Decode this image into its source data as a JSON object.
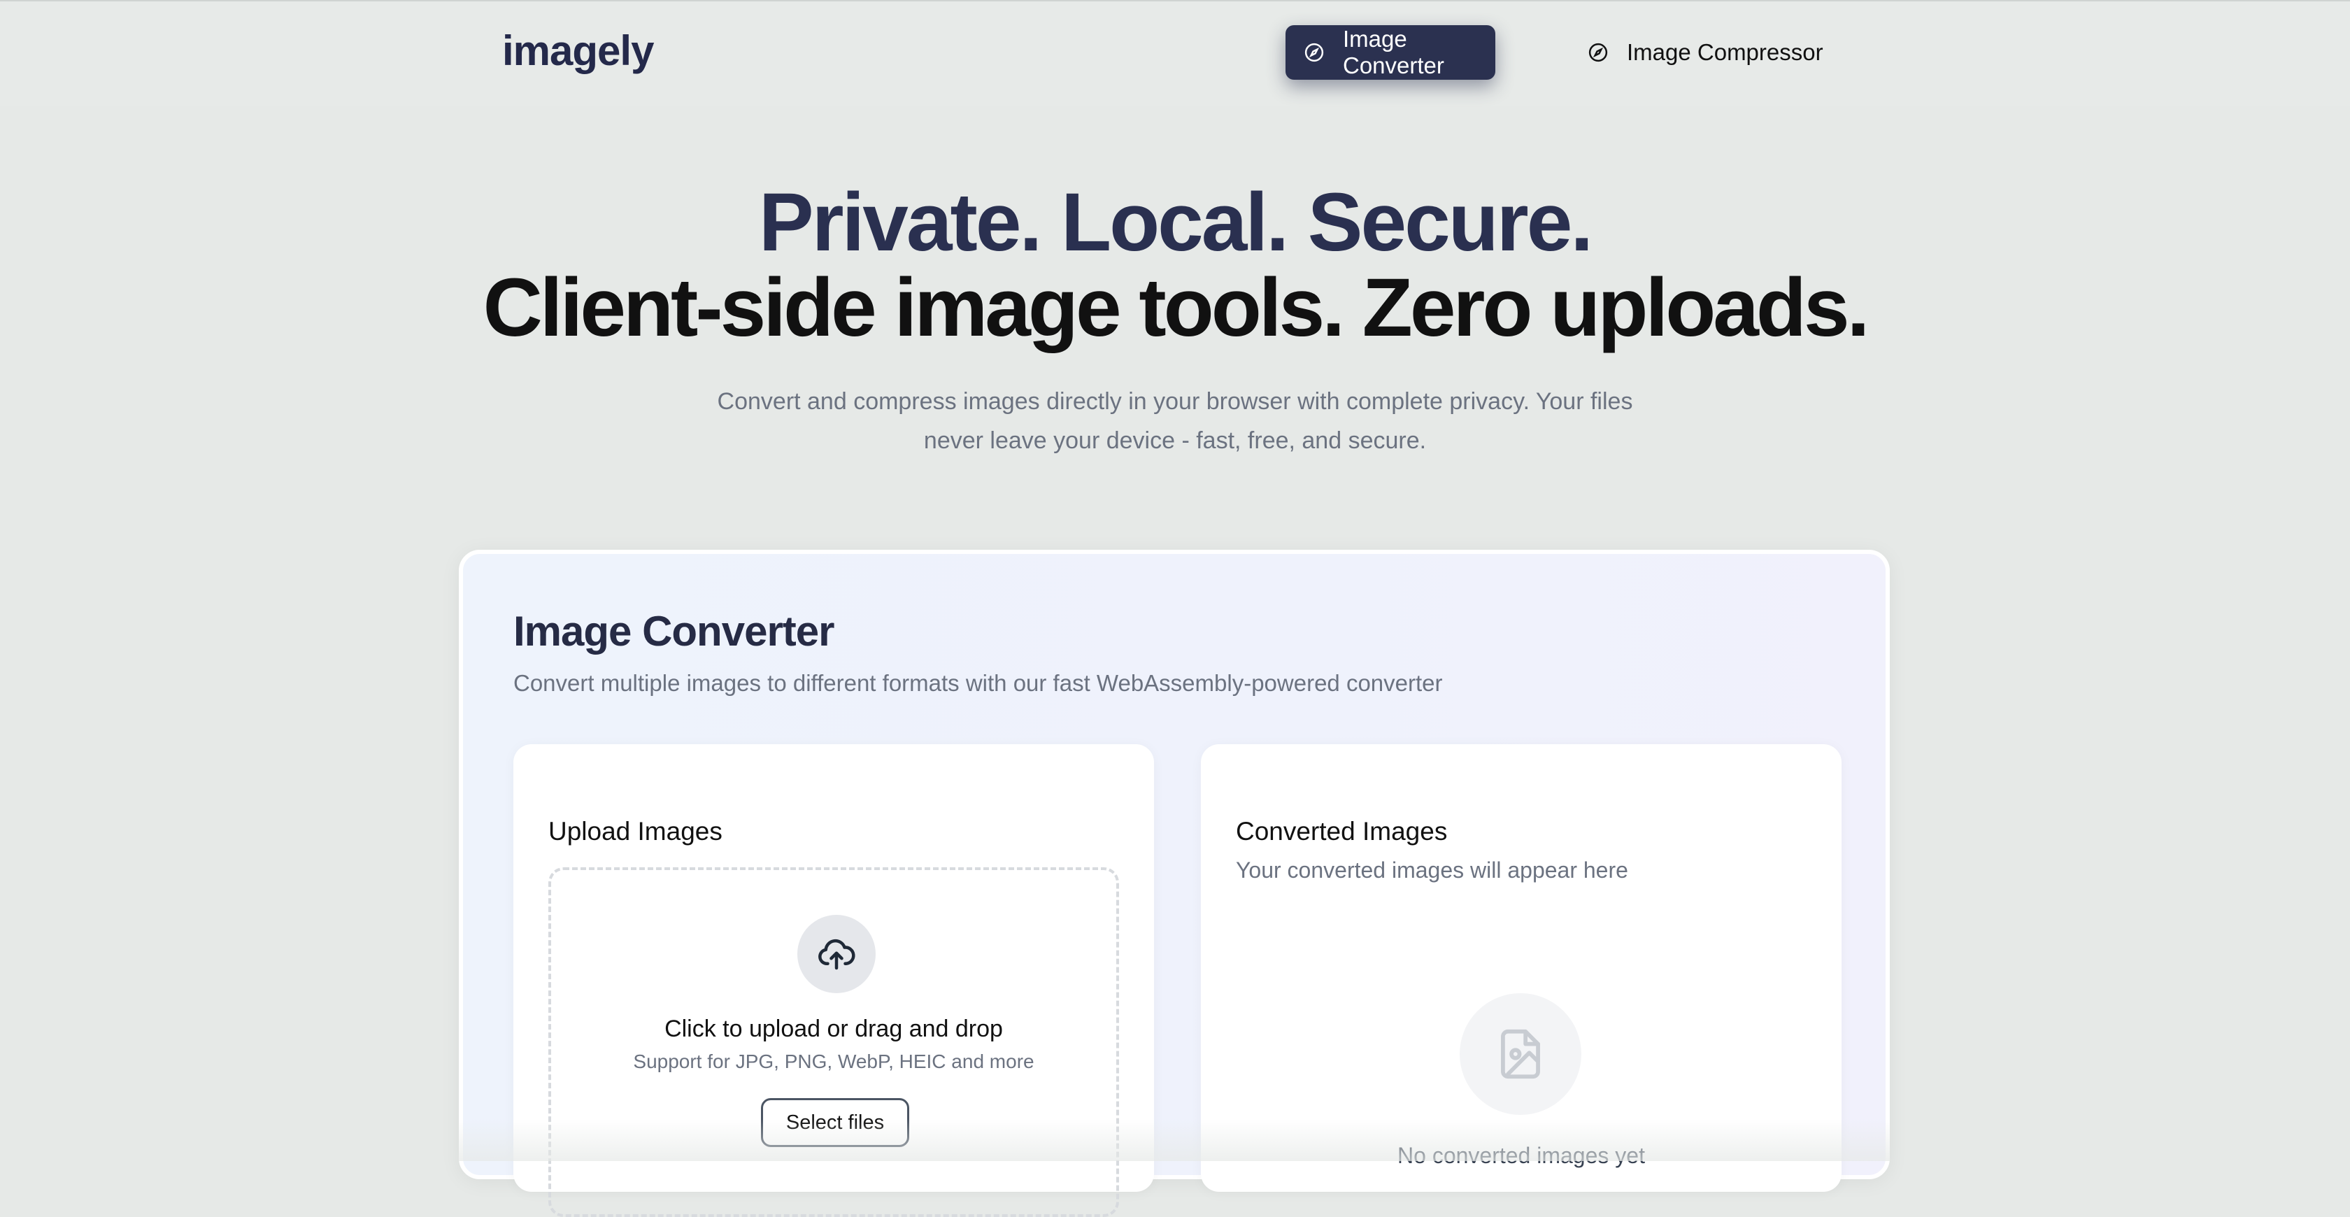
{
  "header": {
    "logo": "imagely",
    "nav": [
      {
        "label": "Image Converter",
        "icon": "compass-icon",
        "active": true
      },
      {
        "label": "Image Compressor",
        "icon": "compass-icon",
        "active": false
      }
    ]
  },
  "hero": {
    "line1": "Private. Local. Secure.",
    "line2": "Client-side image tools. Zero uploads.",
    "subtitle": "Convert and compress images directly in your browser with complete privacy. Your files never leave your device - fast, free, and secure."
  },
  "converter": {
    "title": "Image Converter",
    "subtitle": "Convert multiple images to different formats with our fast WebAssembly-powered converter",
    "upload": {
      "title": "Upload Images",
      "icon": "cloud-upload-icon",
      "dropzone_text": "Click to upload or drag and drop",
      "dropzone_hint": "Support for JPG, PNG, WebP, HEIC and more",
      "select_button": "Select files"
    },
    "results": {
      "title": "Converted Images",
      "subtitle": "Your converted images will appear here",
      "icon": "image-file-icon",
      "empty_text": "No converted images yet"
    }
  },
  "colors": {
    "background": "#e6e9e7",
    "nav_active_bg": "#2b3150",
    "hero_accent": "#2a3050"
  }
}
